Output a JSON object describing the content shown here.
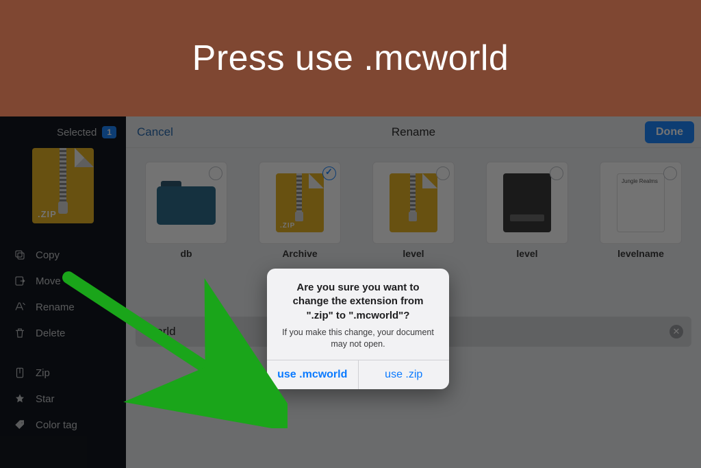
{
  "banner": {
    "text": "Press use .mcworld"
  },
  "sidebar": {
    "selected_label": "Selected",
    "selected_count": "1",
    "thumb_label": ".ZIP",
    "actions": [
      {
        "label": "Copy",
        "icon": "copy"
      },
      {
        "label": "Move",
        "icon": "move"
      },
      {
        "label": "Rename",
        "icon": "rename"
      },
      {
        "label": "Delete",
        "icon": "delete"
      }
    ],
    "actions2": [
      {
        "label": "Zip",
        "icon": "zip"
      },
      {
        "label": "Star",
        "icon": "star"
      },
      {
        "label": "Color tag",
        "icon": "tag"
      }
    ]
  },
  "topbar": {
    "cancel": "Cancel",
    "title": "Rename",
    "done": "Done"
  },
  "files": [
    {
      "name": "db",
      "kind": "folder",
      "selected": false
    },
    {
      "name": "Archive",
      "kind": "zip",
      "selected": true,
      "badge": ".ZIP"
    },
    {
      "name": "level",
      "kind": "zip",
      "selected": false
    },
    {
      "name": "level",
      "kind": "dat",
      "selected": false
    },
    {
      "name": "levelname",
      "kind": "txt",
      "selected": false,
      "preview": "Jungle Realms"
    }
  ],
  "rename": {
    "value_visible": "world"
  },
  "alert": {
    "title": "Are you sure you want to change the extension from \".zip\" to \".mcworld\"?",
    "subtitle": "If you make this change, your document may not open.",
    "primary": "use .mcworld",
    "secondary": "use .zip"
  }
}
